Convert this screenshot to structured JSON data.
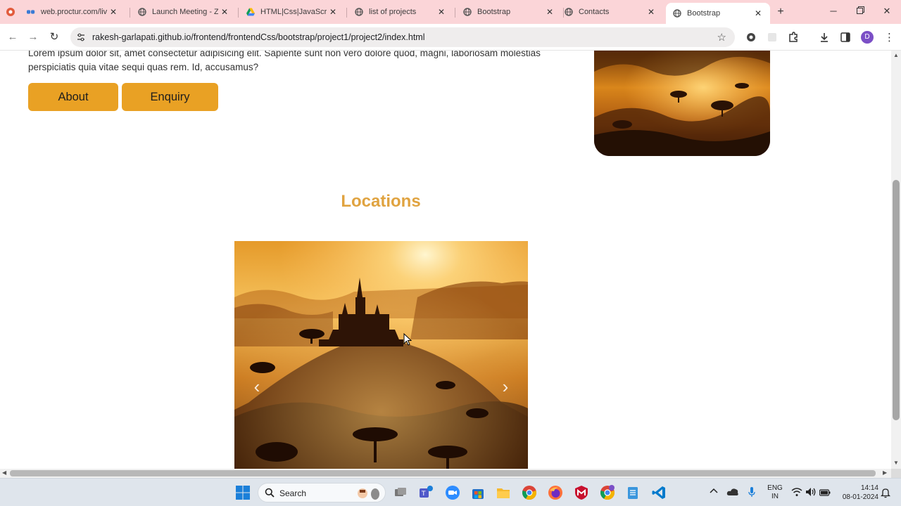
{
  "browser": {
    "tabs": [
      {
        "title": "web.proctur.com/live"
      },
      {
        "title": "Launch Meeting - Zoom"
      },
      {
        "title": "HTML|Css|JavaScript"
      },
      {
        "title": "list of projects"
      },
      {
        "title": "Bootstrap"
      },
      {
        "title": "Contacts"
      },
      {
        "title": "Bootstrap"
      }
    ],
    "new_tab": "+",
    "url": "rakesh-garlapati.github.io/frontend/frontendCss/bootstrap/project1/project2/index.html",
    "profile_initial": "D"
  },
  "page": {
    "lorem": "Lorem ipsum dolor sit, amet consectetur adipisicing elit. Sapiente sunt non vero dolore quod, magni, laboriosam molestias perspiciatis quia vitae sequi quas rem. Id, accusamus?",
    "buttons": {
      "about": "About",
      "enquiry": "Enquiry"
    },
    "locations_title": "Locations",
    "carousel": {
      "prev": "‹",
      "next": "›"
    }
  },
  "taskbar": {
    "search_label": "Search",
    "lang_line1": "ENG",
    "lang_line2": "IN",
    "time": "14:14",
    "date": "08-01-2024"
  },
  "colors": {
    "accent": "#e9a124",
    "title": "#e0a340",
    "tabstrip": "#fbd5d8"
  }
}
